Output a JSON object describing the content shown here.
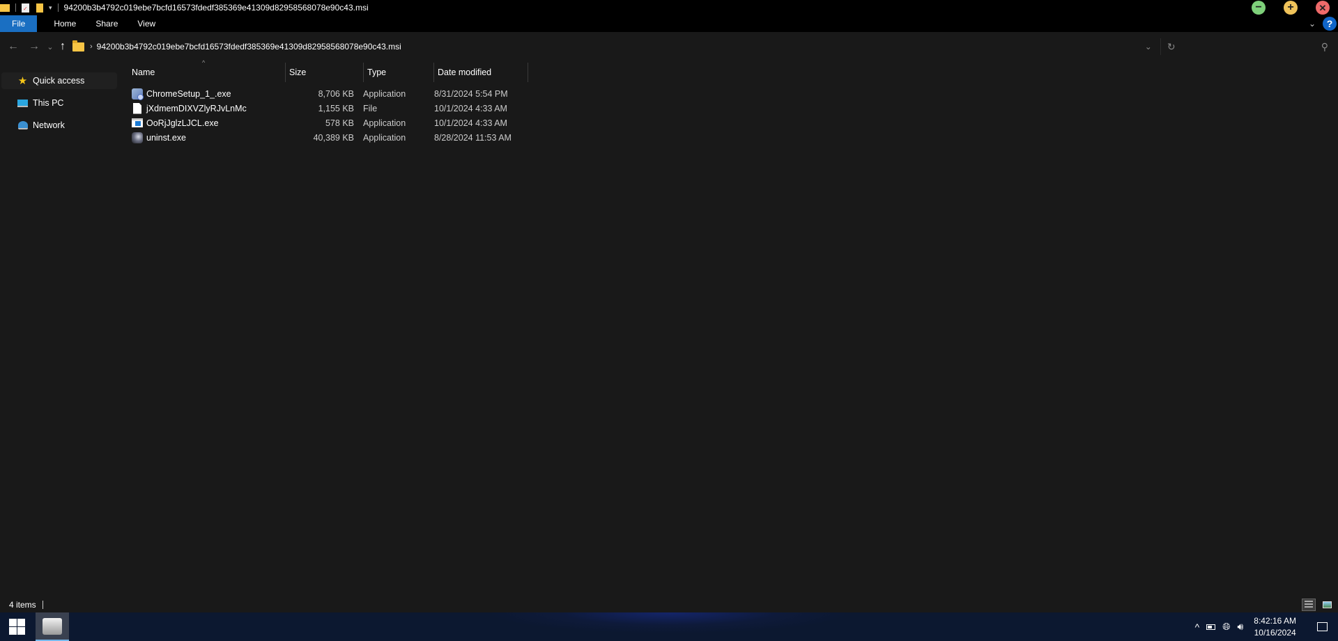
{
  "window": {
    "title": "94200b3b4792c019ebe7bcfd16573fdedf385369e41309d82958568078e90c43.msi",
    "controls": {
      "minimize_icon": "minimize-icon",
      "maximize_icon": "maximize-icon",
      "close_icon": "close-icon"
    }
  },
  "ribbon": {
    "tabs": [
      {
        "label": "File"
      },
      {
        "label": "Home"
      },
      {
        "label": "Share"
      },
      {
        "label": "View"
      }
    ],
    "help_label": "?"
  },
  "address": {
    "back": "←",
    "forward": "→",
    "recent": "⌄",
    "up": "↑",
    "separator": "›",
    "path": "94200b3b4792c019ebe7bcfd16573fdedf385369e41309d82958568078e90c43.msi"
  },
  "sidebar": {
    "items": [
      {
        "label": "Quick access",
        "icon": "star-icon"
      },
      {
        "label": "This PC",
        "icon": "computer-icon"
      },
      {
        "label": "Network",
        "icon": "network-icon"
      }
    ]
  },
  "columns": [
    {
      "label": "Name"
    },
    {
      "label": "Size"
    },
    {
      "label": "Type"
    },
    {
      "label": "Date modified"
    }
  ],
  "files": [
    {
      "name": "ChromeSetup_1_.exe",
      "size": "8,706 KB",
      "type": "Application",
      "date": "8/31/2024 5:54 PM",
      "icon": "installer-icon"
    },
    {
      "name": "jXdmemDIXVZlyRJvLnMc",
      "size": "1,155 KB",
      "type": "File",
      "date": "10/1/2024 4:33 AM",
      "icon": "blank-file-icon"
    },
    {
      "name": "OoRjJglzLJCL.exe",
      "size": "578 KB",
      "type": "Application",
      "date": "10/1/2024 4:33 AM",
      "icon": "application-window-icon"
    },
    {
      "name": "uninst.exe",
      "size": "40,389 KB",
      "type": "Application",
      "date": "8/28/2024 11:53 AM",
      "icon": "app-image-icon"
    }
  ],
  "status": {
    "item_count": "4 items"
  },
  "taskbar": {
    "time": "8:42:16 AM",
    "date": "10/16/2024"
  },
  "colors": {
    "file_tab": "#1a6fc2",
    "minimize": "#7ed07a",
    "maximize": "#f0c35a",
    "close": "#ee6a6a",
    "help": "#0f64c8"
  }
}
